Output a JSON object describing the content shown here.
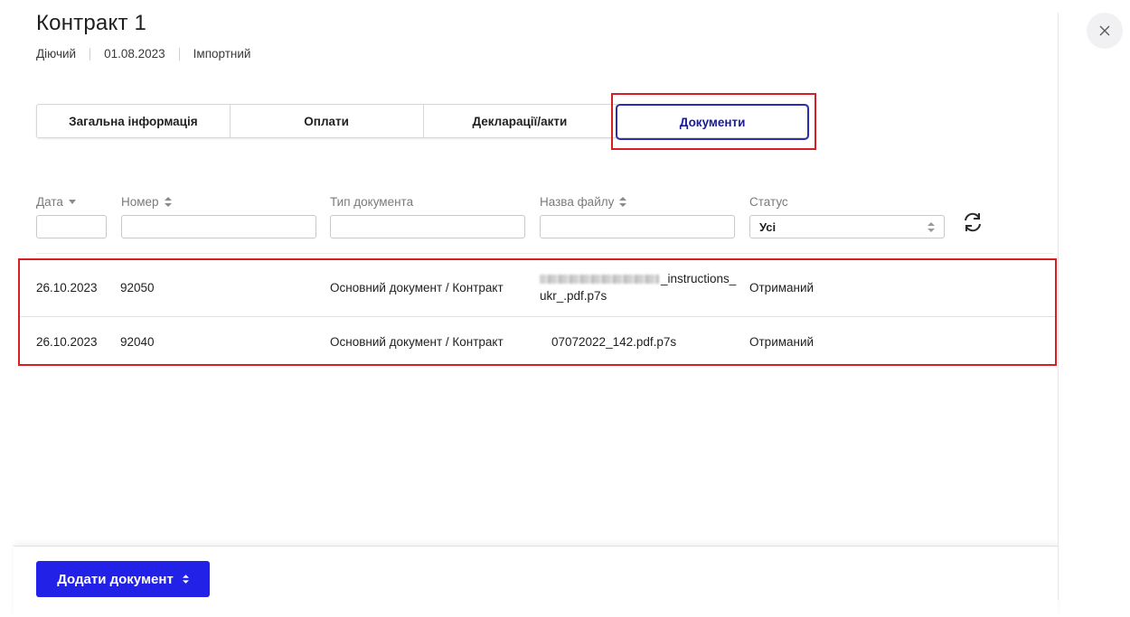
{
  "header": {
    "title": "Контракт 1",
    "status": "Діючий",
    "date": "01.08.2023",
    "type": "Імпортний"
  },
  "tabs": [
    {
      "label": "Загальна інформація"
    },
    {
      "label": "Оплати"
    },
    {
      "label": "Декларації/акти"
    },
    {
      "label": "Документи",
      "active": true
    }
  ],
  "filters": {
    "date_label": "Дата",
    "number_label": "Номер",
    "doc_type_label": "Тип документа",
    "file_name_label": "Назва файлу",
    "status_label": "Статус",
    "status_value": "Усі",
    "date_value": "",
    "number_value": "",
    "doc_type_value": "",
    "file_name_value": ""
  },
  "rows": [
    {
      "date": "26.10.2023",
      "number": "92050",
      "doc_type": "Основний документ / Контракт",
      "file_name_line1": "_instructions_",
      "file_name_line2": "ukr_.pdf.p7s",
      "status": "Отриманий"
    },
    {
      "date": "26.10.2023",
      "number": "92040",
      "doc_type": "Основний документ / Контракт",
      "file_name": "07072022_142.pdf.p7s",
      "status": "Отриманий"
    }
  ],
  "footer": {
    "add_button_label": "Додати документ"
  },
  "colors": {
    "accent": "#2121e8",
    "active_tab_border": "#2c2cae",
    "highlight": "#d32026"
  }
}
